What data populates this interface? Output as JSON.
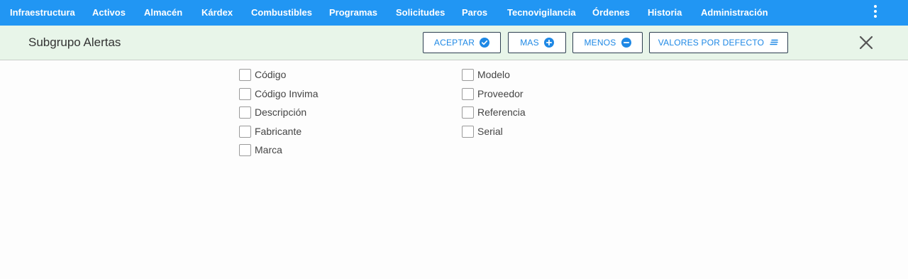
{
  "nav": {
    "items": [
      "Infraestructura",
      "Activos",
      "Almacén",
      "Kárdex",
      "Combustibles",
      "Programas",
      "Solicitudes",
      "Paros",
      "Tecnovigilancia",
      "Órdenes",
      "Historia",
      "Administración"
    ],
    "more_icon": "more-vertical-icon"
  },
  "toolbar": {
    "title": "Subgrupo Alertas",
    "buttons": [
      {
        "label": "ACEPTAR",
        "icon": "check-circle-icon"
      },
      {
        "label": "MAS",
        "icon": "plus-circle-icon"
      },
      {
        "label": "MENOS",
        "icon": "minus-circle-icon"
      },
      {
        "label": "VALORES POR DEFECTO",
        "icon": "lines-icon"
      }
    ],
    "close_icon": "close-icon"
  },
  "options": {
    "col1": [
      {
        "label": "Código",
        "checked": false
      },
      {
        "label": "Código Invima",
        "checked": false
      },
      {
        "label": "Descripción",
        "checked": false
      },
      {
        "label": "Fabricante",
        "checked": false
      },
      {
        "label": "Marca",
        "checked": false
      }
    ],
    "col2": [
      {
        "label": "Modelo",
        "checked": false
      },
      {
        "label": "Proveedor",
        "checked": false
      },
      {
        "label": "Referencia",
        "checked": false
      },
      {
        "label": "Serial",
        "checked": false
      }
    ]
  },
  "colors": {
    "nav_bg": "#2196f3",
    "toolbar_bg": "#e8f5e9",
    "accent": "#1e88e5"
  }
}
